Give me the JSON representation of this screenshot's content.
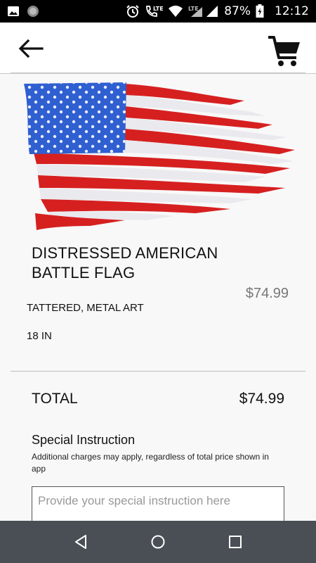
{
  "status_bar": {
    "battery_percent": "87%",
    "time": "12:12",
    "network_label_1": "LTE",
    "network_label_2": "LTE",
    "icons": [
      "image-icon",
      "circle-notification-icon",
      "alarm-icon",
      "call-lte-icon",
      "wifi-icon",
      "signal-icon",
      "battery-icon"
    ]
  },
  "app_bar": {
    "back_icon": "arrow-left-icon",
    "cart_icon": "cart-icon"
  },
  "product": {
    "image_desc_icon": "flag-image",
    "title": "DISTRESSED AMERICAN BATTLE FLAG",
    "price": "$74.99",
    "option_1": "TATTERED, METAL ART",
    "option_2": "18 IN"
  },
  "total": {
    "label": "TOTAL",
    "value": "$74.99"
  },
  "special_instruction": {
    "title": "Special Instruction",
    "note": "Additional charges may apply, regardless of total price shown in app",
    "placeholder": "Provide your special instruction here",
    "value": ""
  },
  "nav_bar": {
    "icons": [
      "back-triangle-icon",
      "home-circle-icon",
      "recents-square-icon"
    ]
  },
  "colors": {
    "status_bar_bg": "#000000",
    "nav_bar_bg": "#4a4f55",
    "price_gray": "#777777",
    "flag_red": "#d62020",
    "flag_blue": "#2f5fd0"
  }
}
